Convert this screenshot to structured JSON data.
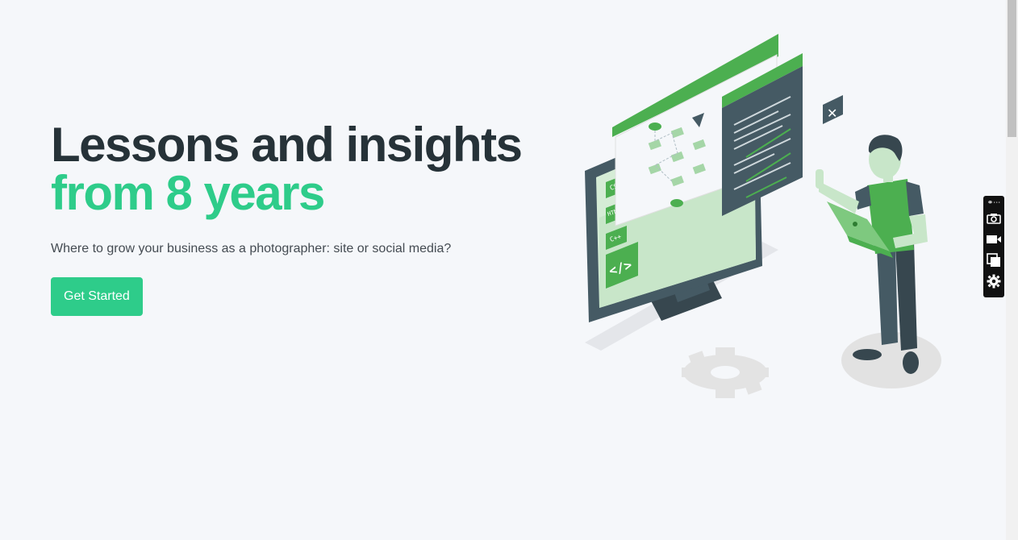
{
  "hero": {
    "title_line1": "Lessons and insights",
    "title_line2": "from 8 years",
    "subtitle": "Where to grow your business as a photographer: site or social media?",
    "cta_label": "Get Started"
  },
  "illustration": {
    "code_tags": [
      "CSS",
      "HTML",
      "C++"
    ],
    "code_symbol": "</>"
  },
  "toolbar": {
    "icons": [
      "link-more-icon",
      "camera-icon",
      "video-icon",
      "copy-icon",
      "gear-icon"
    ]
  },
  "colors": {
    "accent": "#2ecc8a",
    "title": "#263238",
    "illustration_green": "#4caf50",
    "illustration_dark": "#455a64",
    "background": "#f5f7fa"
  }
}
